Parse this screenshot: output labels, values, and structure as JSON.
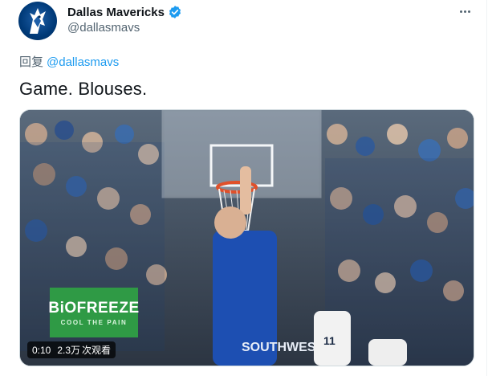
{
  "account": {
    "display_name": "Dallas Mavericks",
    "handle": "@dallasmavs",
    "verified_icon": "verified-badge-icon",
    "avatar_icon": "mavericks-horse-logo"
  },
  "more_icon": "more-horizontal-icon",
  "reply": {
    "prefix": "回复",
    "mention": "@dallasmavs"
  },
  "tweet": {
    "text": "Game. Blouses."
  },
  "video": {
    "time": "0:10",
    "views_count": "2.3万",
    "views_label": "次观看",
    "sponsor_brand": "BiOFREEZE",
    "sponsor_tagline": "COOL THE PAIN",
    "jersey_text": "SOUTHWEST"
  },
  "colors": {
    "link": "#1d9bf0",
    "secondary_text": "#536471",
    "sponsor_green": "#2f9a45"
  }
}
